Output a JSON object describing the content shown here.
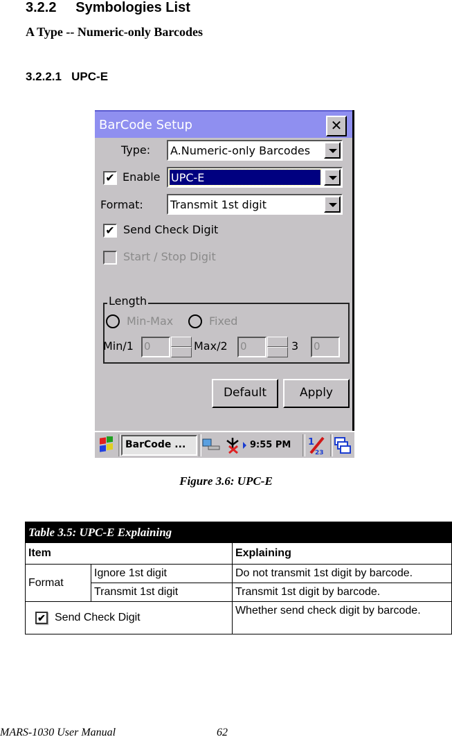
{
  "document": {
    "section_heading": "3.2.2     Symbologies List",
    "subheading": "A Type -- Numeric-only Barcodes",
    "subsection_heading": "3.2.2.1   UPC-E",
    "figure_caption": "Figure 3.6: UPC-E",
    "footer_manual": "MARS-1030 User Manual",
    "footer_page": "62"
  },
  "dialog": {
    "title": "BarCode Setup",
    "close_label": "✕",
    "type_label": "Type:",
    "type_value": "A.Numeric-only Barcodes",
    "enable_label": "Enable",
    "enable_checked": true,
    "symbology_value": "UPC-E",
    "format_label": "Format:",
    "format_value": "Transmit 1st digit",
    "send_check_digit_label": "Send Check Digit",
    "send_check_digit_checked": true,
    "start_stop_label": "Start / Stop Digit",
    "start_stop_checked": false,
    "length_group_label": "Length",
    "radio_minmax_label": "Min-Max",
    "radio_fixed_label": "Fixed",
    "min_label": "Min/1",
    "min_value": "0",
    "max_label": "Max/2",
    "max_value": "0",
    "third_label": "3",
    "third_value": "0",
    "default_button": "Default",
    "apply_button": "Apply",
    "check_glyph": "✔"
  },
  "taskbar": {
    "app_button": "BarCode ...",
    "clock": "9:55 PM",
    "input_indicator": "1/23"
  },
  "table": {
    "caption": "Table 3.5: UPC-E Explaining",
    "headers": [
      "Item",
      "Explaining"
    ],
    "rows": [
      {
        "item": "Format",
        "option": "Ignore 1st digit",
        "explaining": "Do not transmit 1st digit by barcode."
      },
      {
        "item": "Format",
        "option": "Transmit 1st digit",
        "explaining": "Transmit 1st digit by barcode."
      },
      {
        "item": "Send Check Digit",
        "explaining": "Whether send check digit by barcode."
      }
    ]
  }
}
